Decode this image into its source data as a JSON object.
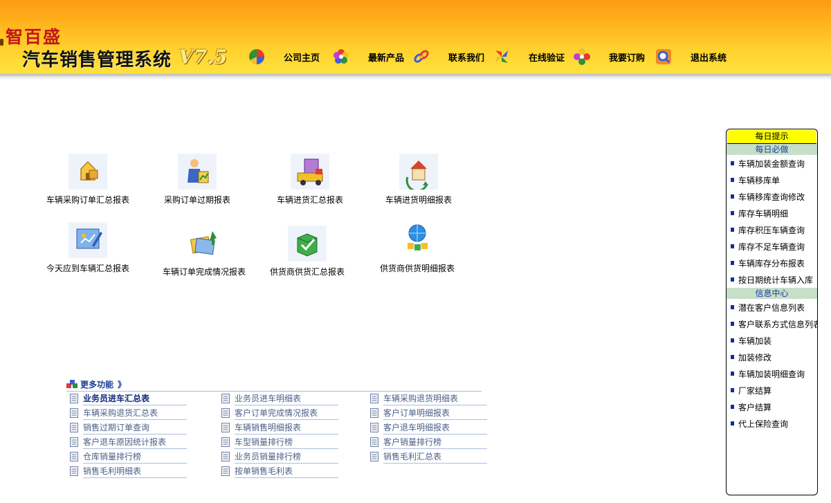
{
  "brand": {
    "sub": "智百盛",
    "title": "汽车销售管理系统",
    "version": "V7.5"
  },
  "nav": [
    {
      "label": "公司主页",
      "icon": "pie-chart-icon"
    },
    {
      "label": "最新产品",
      "icon": "color-wheel-icon"
    },
    {
      "label": "联系我们",
      "icon": "link-chain-icon"
    },
    {
      "label": "在线验证",
      "icon": "pinwheel-icon"
    },
    {
      "label": "我要订购",
      "icon": "flower-icon"
    },
    {
      "label": "退出系统",
      "icon": "magnifier-icon"
    }
  ],
  "reports": [
    {
      "label": "车辆采购订单汇总报表",
      "icon": "house-package-icon"
    },
    {
      "label": "采购订单过期报表",
      "icon": "worker-chart-icon"
    },
    {
      "label": "车辆进货汇总报表",
      "icon": "truck-icon"
    },
    {
      "label": "车辆进货明细报表",
      "icon": "house-refresh-icon"
    },
    {
      "label": "今天应到车辆汇总报表",
      "icon": "document-edit-icon"
    },
    {
      "label": "车辆订单完成情况报表",
      "icon": "folders-arrow-icon"
    },
    {
      "label": "供货商供货汇总报表",
      "icon": "box-check-icon"
    },
    {
      "label": "供货商供货明细报表",
      "icon": "globe-people-icon"
    }
  ],
  "more": {
    "title": "更多功能",
    "arrows": "》",
    "columns": [
      [
        "业务员进车汇总表",
        "车辆采购退货汇总表",
        "销售过期订单查询",
        "客户退车原因统计报表",
        "仓库销量排行榜",
        "销售毛利明细表"
      ],
      [
        "业务员进车明细表",
        "客户订单完成情况报表",
        "车辆销售明细报表",
        "车型销量排行榜",
        "业务员销量排行榜",
        "按单销售毛利表"
      ],
      [
        "车辆采购退货明细表",
        "客户订单明细报表",
        "客户退车明细报表",
        "客户销量排行榜",
        "销售毛利汇总表"
      ]
    ]
  },
  "panel": {
    "title": "每日提示",
    "sections": [
      {
        "title": "每日必做",
        "items": [
          "车辆加装金额查询",
          "车辆移库单",
          "车辆移库查询修改",
          "库存车辆明细",
          "库存积压车辆查询",
          "库存不足车辆查询",
          "车辆库存分布报表",
          "按日期统计车辆入库"
        ]
      },
      {
        "title": "信息中心",
        "items": [
          "潜在客户信息列表",
          "客户联系方式信息列表",
          "车辆加装",
          "加装修改",
          "车辆加装明细查询",
          "厂家结算",
          "客户结算",
          "代上保险查询"
        ]
      }
    ]
  }
}
